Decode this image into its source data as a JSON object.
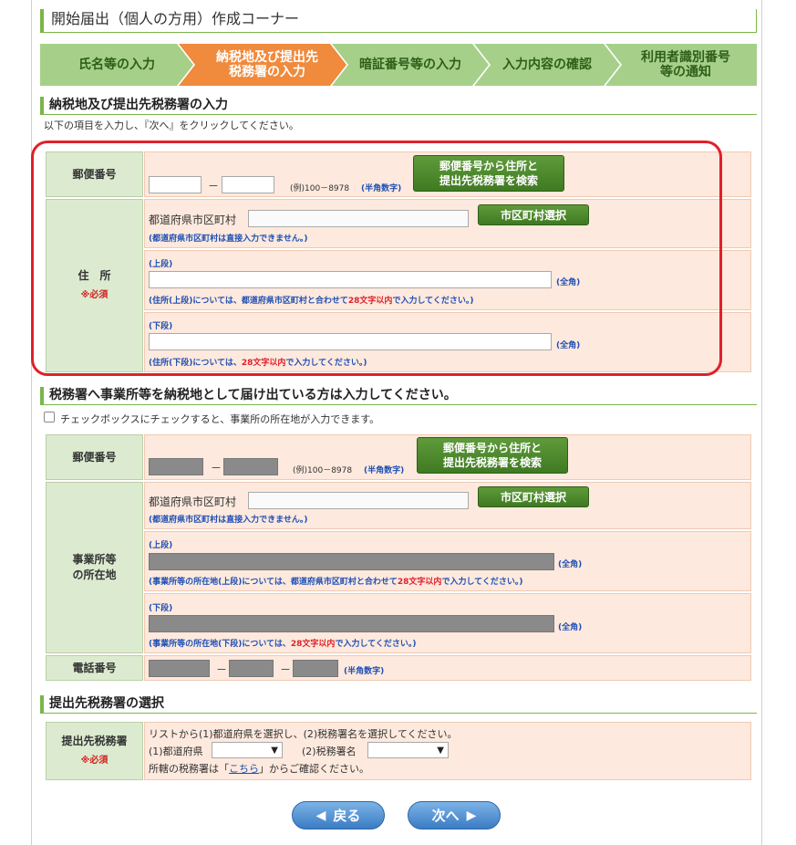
{
  "title": "開始届出（個人の方用）作成コーナー",
  "steps": [
    {
      "label": "氏名等の入力",
      "active": false
    },
    {
      "label": "納税地及び提出先\n税務署の入力",
      "active": true
    },
    {
      "label": "暗証番号等の入力",
      "active": false
    },
    {
      "label": "入力内容の確認",
      "active": false
    },
    {
      "label": "利用者識別番号\n等の通知",
      "active": false
    }
  ],
  "section1": {
    "heading": "納税地及び提出先税務署の入力",
    "instruction": "以下の項目を入力し、『次へ』をクリックしてください。",
    "postal": {
      "label": "郵便番号",
      "dash": "－",
      "example": "(例)100－8978",
      "note": "(半角数字)",
      "search_button": "郵便番号から住所と\n提出先税務署を検索"
    },
    "address": {
      "label": "住　所",
      "required": "※必須",
      "pref_label": "都道府県市区町村",
      "pref_note": "(都道府県市区町村は直接入力できません。)",
      "city_button": "市区町村選択",
      "upper_label": "(上段)",
      "upper_zen": "(全角)",
      "upper_note_a": "(住所(上段)については、都道府県市区町村と合わせて",
      "upper_note_red": "28文字以内",
      "upper_note_b": "で入力してください。)",
      "lower_label": "(下段)",
      "lower_zen": "(全角)",
      "lower_note_a": "(住所(下段)については、",
      "lower_note_red": "28文字以内",
      "lower_note_b": "で入力してください。)"
    }
  },
  "section2": {
    "heading": "税務署へ事業所等を納税地として届け出ている方は入力してください。",
    "checkbox_label": "チェックボックスにチェックすると、事業所の所在地が入力できます。",
    "postal": {
      "label": "郵便番号",
      "dash": "－",
      "example": "(例)100－8978",
      "note": "(半角数字)",
      "search_button": "郵便番号から住所と\n提出先税務署を検索"
    },
    "office": {
      "label": "事業所等\nの所在地",
      "pref_label": "都道府県市区町村",
      "pref_note": "(都道府県市区町村は直接入力できません。)",
      "city_button": "市区町村選択",
      "upper_label": "(上段)",
      "upper_zen": "(全角)",
      "upper_note_a": "(事業所等の所在地(上段)については、都道府県市区町村と合わせて",
      "upper_note_red": "28文字以内",
      "upper_note_b": "で入力してください。)",
      "lower_label": "(下段)",
      "lower_zen": "(全角)",
      "lower_note_a": "(事業所等の所在地(下段)については、",
      "lower_note_red": "28文字以内",
      "lower_note_b": "で入力してください。)"
    },
    "phone": {
      "label": "電話番号",
      "dash": "－",
      "note": "(半角数字)"
    }
  },
  "section3": {
    "heading": "提出先税務署の選択",
    "label": "提出先税務署",
    "required": "※必須",
    "line1": "リストから(1)都道府県を選択し、(2)税務署名を選択してください。",
    "pref_select_label": "(1)都道府県",
    "office_select_label": "(2)税務署名",
    "line3_a": "所轄の税務署は「",
    "line3_link": "こちら",
    "line3_b": "」からご確認ください。"
  },
  "nav": {
    "back": "戻る",
    "next": "次へ"
  },
  "colors": {
    "accent_green": "#7ab648",
    "active_step": "#f08a3c",
    "highlight_red": "#e0202a"
  }
}
